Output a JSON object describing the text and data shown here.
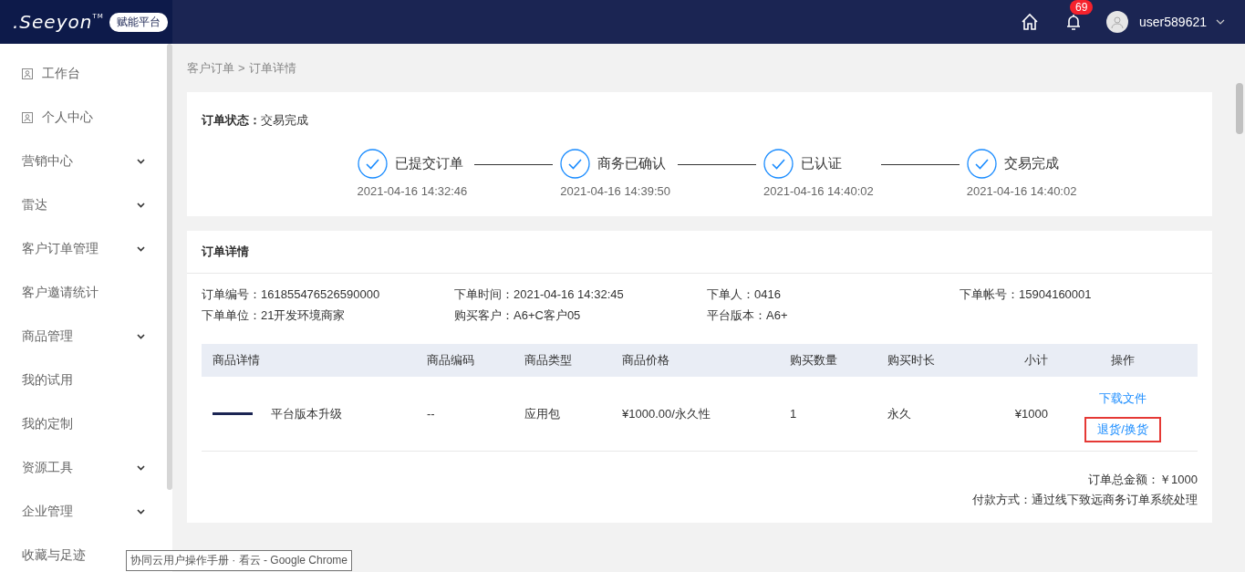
{
  "header": {
    "logo": {
      "text": ".Seeyon",
      "mark": "TM"
    },
    "badge": "赋能平台",
    "notification_count": "69",
    "username": "user589621"
  },
  "sidebar": {
    "items": [
      {
        "label": "工作台",
        "kind": "icon-link"
      },
      {
        "label": "个人中心",
        "kind": "icon-link"
      },
      {
        "label": "营销中心",
        "kind": "group"
      },
      {
        "label": "雷达",
        "kind": "group"
      },
      {
        "label": "客户订单管理",
        "kind": "group"
      },
      {
        "label": "客户邀请统计",
        "kind": "link"
      },
      {
        "label": "商品管理",
        "kind": "group"
      },
      {
        "label": "我的试用",
        "kind": "link"
      },
      {
        "label": "我的定制",
        "kind": "link"
      },
      {
        "label": "资源工具",
        "kind": "group"
      },
      {
        "label": "企业管理",
        "kind": "group"
      },
      {
        "label": "收藏与足迹",
        "kind": "link"
      }
    ]
  },
  "breadcrumb": [
    "客户订单",
    "订单详情"
  ],
  "breadcrumb_separator": ">",
  "order_status": {
    "label": "订单状态：",
    "value": "交易完成",
    "steps": [
      {
        "label": "已提交订单",
        "time": "2021-04-16 14:32:46",
        "done": true
      },
      {
        "label": "商务已确认",
        "time": "2021-04-16 14:39:50",
        "done": true
      },
      {
        "label": "已认证",
        "time": "2021-04-16 14:40:02",
        "done": true
      },
      {
        "label": "交易完成",
        "time": "2021-04-16 14:40:02",
        "done": true
      }
    ]
  },
  "order_detail": {
    "title": "订单详情",
    "fields": [
      {
        "label": "订单编号：",
        "value": "161855476526590000"
      },
      {
        "label": "下单时间：",
        "value": "2021-04-16 14:32:45"
      },
      {
        "label": "下单人：",
        "value": "0416"
      },
      {
        "label": "下单帐号：",
        "value": "15904160001"
      },
      {
        "label": "下单单位：",
        "value": "21开发环境商家"
      },
      {
        "label": "购买客户：",
        "value": "A6+C客户05"
      },
      {
        "label": "平台版本：",
        "value": "A6+"
      }
    ],
    "table": {
      "columns": [
        "商品详情",
        "商品编码",
        "商品类型",
        "商品价格",
        "购买数量",
        "购买时长",
        "小计",
        "操作"
      ],
      "rows": [
        {
          "cells": [
            "平台版本升级",
            "--",
            "应用包",
            "¥1000.00/永久性",
            "1",
            "永久",
            "¥1000"
          ],
          "actions": [
            {
              "label": "下载文件",
              "highlighted": false
            },
            {
              "label": "退货/换货",
              "highlighted": true
            }
          ]
        }
      ]
    },
    "total": "订单总金额：￥1000",
    "payment": "付款方式：通过线下致远商务订单系统处理"
  },
  "tooltip": "协同云用户操作手册 · 看云 - Google Chrome"
}
